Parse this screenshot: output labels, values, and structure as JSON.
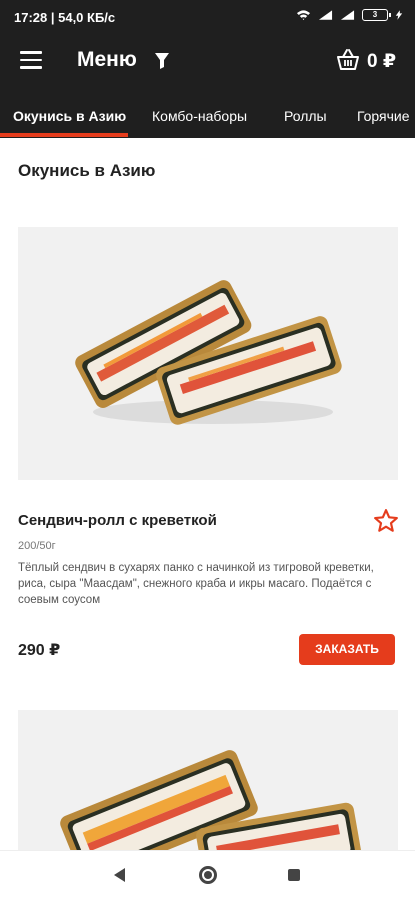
{
  "status_bar": {
    "time": "17:28 | 54,0 КБ/с",
    "battery": "3"
  },
  "app_bar": {
    "title": "Меню",
    "cart_total": "0 ₽"
  },
  "tabs": [
    {
      "label": "Окунись в Азию",
      "active": true
    },
    {
      "label": "Комбо-наборы",
      "active": false
    },
    {
      "label": "Роллы",
      "active": false
    },
    {
      "label": "Горячие",
      "active": false
    }
  ],
  "section": {
    "title": "Окунись в Азию"
  },
  "products": [
    {
      "name": "Сендвич-ролл с креветкой",
      "weight": "200/50г",
      "description": "Тёплый сендвич в сухарях панко с начинкой из тигровой креветки, риса, сыра \"Маасдам\", снежного краба и икры масаго. Подаётся с соевым соусом",
      "price": "290 ₽",
      "order_label": "ЗАКАЗАТЬ"
    }
  ],
  "colors": {
    "header_bg": "#1f1f1f",
    "accent": "#e53c1c"
  }
}
